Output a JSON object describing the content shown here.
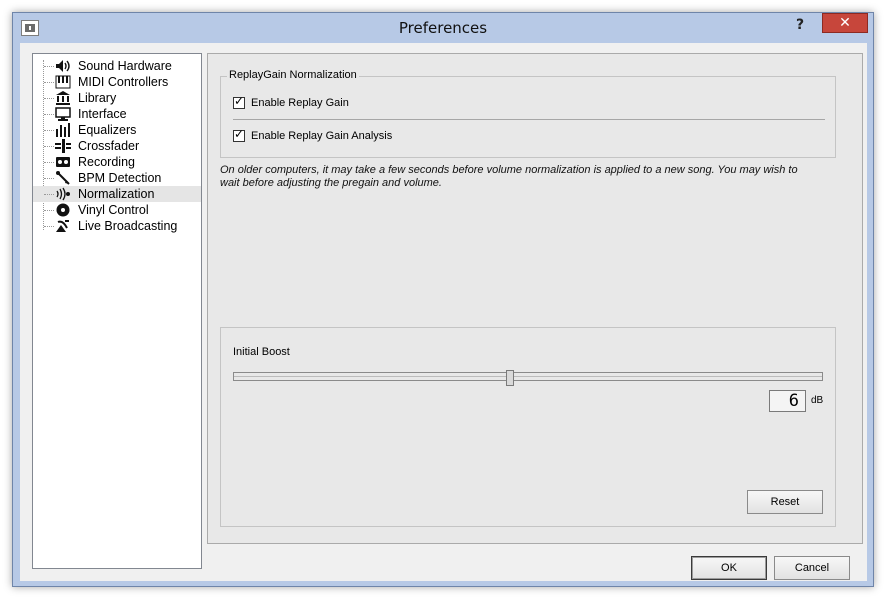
{
  "window": {
    "title": "Preferences",
    "help_glyph": "?",
    "close_glyph": "✕"
  },
  "nav": {
    "items": [
      {
        "label": "Sound Hardware",
        "icon": "speaker-icon",
        "selected": false
      },
      {
        "label": "MIDI Controllers",
        "icon": "midi-keyboard-icon",
        "selected": false
      },
      {
        "label": "Library",
        "icon": "library-icon",
        "selected": false
      },
      {
        "label": "Interface",
        "icon": "monitor-icon",
        "selected": false
      },
      {
        "label": "Equalizers",
        "icon": "equalizer-icon",
        "selected": false
      },
      {
        "label": "Crossfader",
        "icon": "crossfader-icon",
        "selected": false
      },
      {
        "label": "Recording",
        "icon": "recording-icon",
        "selected": false
      },
      {
        "label": "BPM Detection",
        "icon": "bpm-icon",
        "selected": false
      },
      {
        "label": "Normalization",
        "icon": "normalization-icon",
        "selected": true
      },
      {
        "label": "Vinyl Control",
        "icon": "vinyl-icon",
        "selected": false
      },
      {
        "label": "Live Broadcasting",
        "icon": "broadcast-icon",
        "selected": false
      }
    ]
  },
  "replaygain": {
    "group_title": "ReplayGain Normalization",
    "enable_replay_gain_label": "Enable Replay Gain",
    "enable_replay_gain_checked": true,
    "enable_analysis_label": "Enable Replay Gain Analysis",
    "enable_analysis_checked": true
  },
  "info_text": "On older computers, it may take a few seconds before volume normalization is applied to a new song. You may wish to wait before adjusting the pregain and volume.",
  "boost": {
    "label": "Initial Boost",
    "value_display": "6",
    "unit": "dB",
    "slider_fraction": 0.47,
    "reset_label": "Reset"
  },
  "footer": {
    "ok_label": "OK",
    "cancel_label": "Cancel"
  }
}
